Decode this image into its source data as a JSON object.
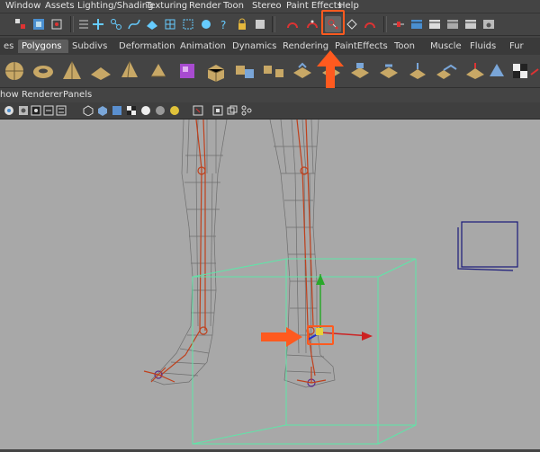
{
  "menubar": {
    "items": [
      "Window",
      "Assets",
      "Lighting/Shading",
      "Texturing",
      "Render",
      "Toon",
      "Stereo",
      "Paint Effects",
      "Help"
    ]
  },
  "shelf_tabs": {
    "items": [
      "es",
      "Polygons",
      "Subdivs",
      "Deformation",
      "Animation",
      "Dynamics",
      "Rendering",
      "PaintEffects",
      "Toon",
      "Muscle",
      "Fluids",
      "Fur"
    ],
    "active": "Polygons"
  },
  "panel_menu": {
    "items": [
      "how",
      "Renderer",
      "Panels"
    ]
  },
  "colors": {
    "viewport_bg": "#a8a8a8",
    "wireframe": "#6e6e6e",
    "joints": "#c0401c",
    "bounding_box": "#5ee6a8",
    "camera_frame": "#1a1a7a",
    "callout": "#ff5a1f"
  },
  "icons": {
    "highlighted_tool": "ik-handle-icon",
    "manipulator": "move-manipulator-icon"
  }
}
